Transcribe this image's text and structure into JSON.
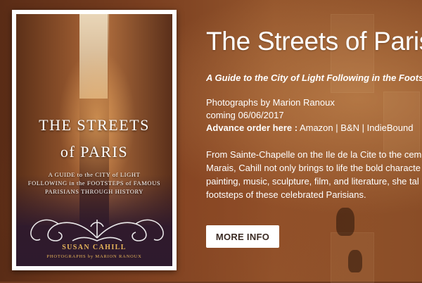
{
  "book": {
    "cover_title_line1": "THE STREETS",
    "cover_title_line2": "of PARIS",
    "cover_subtitle_line1": "A GUIDE to the CITY of LIGHT",
    "cover_subtitle_line2": "FOLLOWING in the FOOTSTEPS of FAMOUS",
    "cover_subtitle_line3": "PARISIANS THROUGH HISTORY",
    "cover_author": "SUSAN CAHILL",
    "cover_photographer": "PHOTOGRAPHS by MARION RANOUX"
  },
  "main": {
    "title": "The Streets of Paris",
    "subtitle": "A Guide to the City of Light Following in the Footsteps of",
    "photographs": "Photographs by Marion Ranoux",
    "coming": "coming 06/06/2017",
    "advance_label": "Advance order here :",
    "links": [
      "Amazon",
      "B&N",
      "IndieBound"
    ],
    "separator": "|",
    "description_lines": [
      "From Sainte-Chapelle on the Ile de la Cite to the ceme",
      "Marais, Cahill not only brings to life the bold characte",
      "painting, music, sculpture, film, and literature, she tal",
      "footsteps of these celebrated Parisians."
    ],
    "more_info_label": "MORE INFO"
  },
  "colors": {
    "accent_text": "#ffffff",
    "button_bg": "#ffffff",
    "button_text": "#3a2a22",
    "cover_gold": "#e8b55a"
  }
}
